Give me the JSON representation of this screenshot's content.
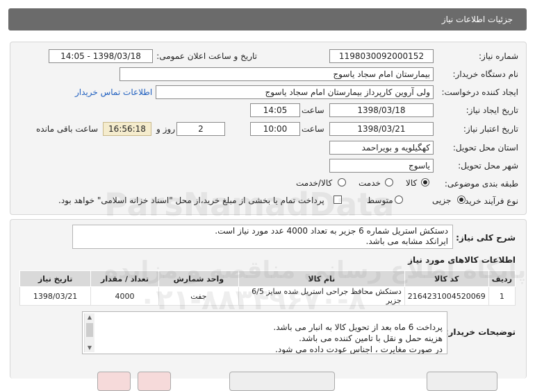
{
  "header": {
    "title": "جزئیات اطلاعات نیاز"
  },
  "form": {
    "need_number_label": "شماره نیاز:",
    "need_number": "1198030092000152",
    "announce_label": "تاریخ و ساعت اعلان عمومی:",
    "announce_value": "1398/03/18 - 14:05",
    "buyer_org_label": "نام دستگاه خریدار:",
    "buyer_org": "بیمارستان امام سجاد یاسوج",
    "requester_label": "ایجاد کننده درخواست:",
    "requester": "ولی آروین کارپرداز بیمارستان امام سجاد یاسوج",
    "contact_link": "اطلاعات تماس خریدار",
    "created_date_label": "تاریخ ایجاد نیاز:",
    "created_date": "1398/03/18",
    "hour_label": "ساعت",
    "created_time": "14:05",
    "validity_label": "تاریخ اعتبار نیاز:",
    "validity_date": "1398/03/21",
    "validity_time": "10:00",
    "days": "2",
    "days_label": "روز و",
    "remaining_time": "16:56:18",
    "remaining_label": "ساعت باقی مانده",
    "province_label": "استان محل تحویل:",
    "province": "کهگیلویه و بویراحمد",
    "city_label": "شهر محل تحویل:",
    "city": "یاسوج",
    "category_label": "طبقه بندی موضوعی:",
    "category_options": [
      "کالا",
      "خدمت",
      "کالا/خدمت"
    ],
    "purchase_type_label": "نوع فرآیند خرید :",
    "purchase_options": [
      "جزیی",
      "متوسط"
    ],
    "payment_note": "پرداخت تمام یا بخشی از مبلغ خرید،از محل \"اسناد خزانه اسلامی\" خواهد بود."
  },
  "description": {
    "label": "شرح کلی نیاز:",
    "text_line1": "دستکش استریل شماره 6 جزیر به تعداد 4000 عدد مورد نیاز است.",
    "text_line2": "ایرانکد مشابه می باشد."
  },
  "items_section": {
    "title": "اطلاعات کالاهای مورد نیاز",
    "columns": [
      "ردیف",
      "کد کالا",
      "نام کالا",
      "واحد شمارش",
      "تعداد / مقدار",
      "تاریخ نیاز"
    ],
    "rows": [
      [
        "1",
        "2164231004520069",
        "دستکش محافظ جراحی استریل شده سایز 6/5 جزیر",
        "جفت",
        "4000",
        "1398/03/21"
      ]
    ]
  },
  "buyer_notes": {
    "label": "توضیحات خریدار:",
    "line1": "پرداخت 6 ماه بعد از تحویل کالا به انبار می باشد.",
    "line2": "هزینه حمل و نقل با تامین کننده می باشد.",
    "line3": "در صورت مغایرت ، اجناس عودت داده می شود."
  },
  "watermark": {
    "line1": "ParsNamadData",
    "line2": "پایگاه اطلاع رسانی مناقصه و مزایده",
    "phone": "۰۲۱-۸۸۳۴۹۶۷۰-۸"
  },
  "colors": {
    "titlebar": "#6b6b6b",
    "panel": "#f4f4f4",
    "remaining_bg": "#f5eccd",
    "link": "#1f5fbf"
  }
}
